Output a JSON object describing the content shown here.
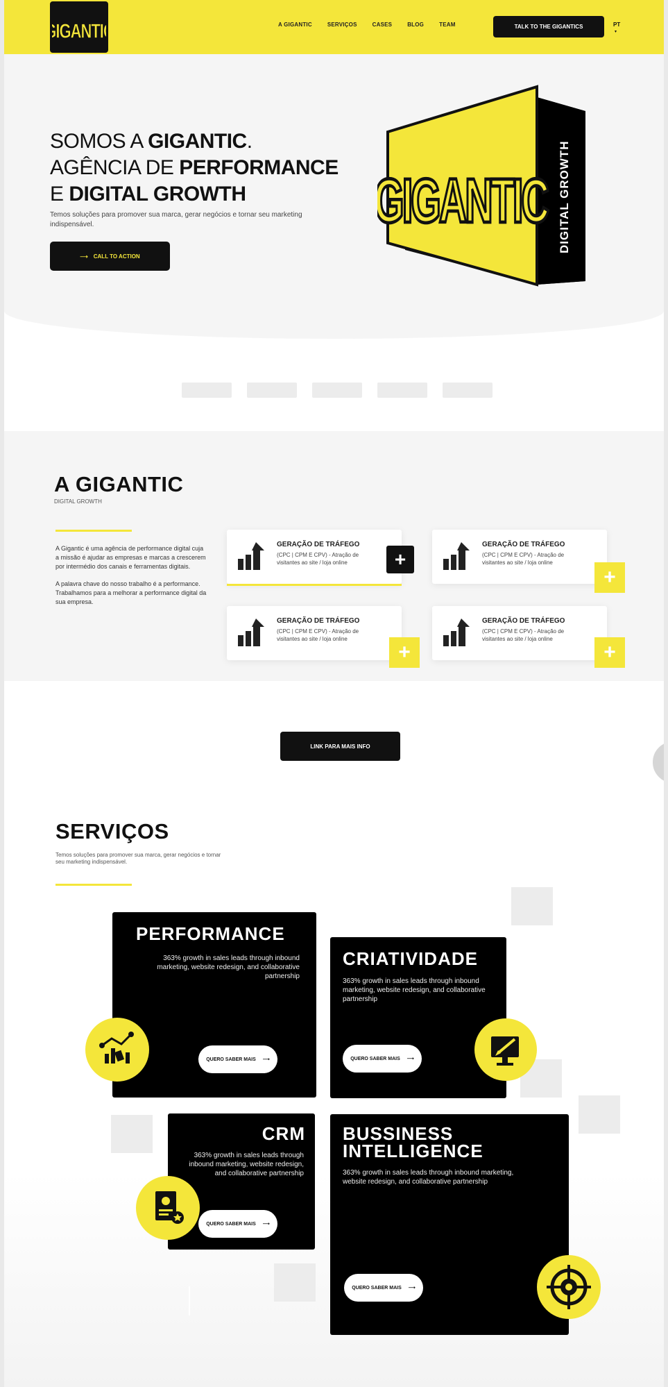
{
  "header": {
    "logo_text": "GIGANTIC",
    "nav": [
      "A GIGANTIC",
      "SERVIÇOS",
      "CASES",
      "BLOG",
      "TEAM"
    ],
    "cta_label": "TALK TO THE GIGANTICS",
    "lang": "PT",
    "lang_caret": "▾"
  },
  "hero": {
    "title_1a": "SOMOS A ",
    "title_1b": "GIGANTIC",
    "title_1c": ".",
    "title_2a": "AGÊNCIA DE ",
    "title_2b": "PERFORMANCE",
    "title_3a": "E ",
    "title_3b": "DIGITAL GROWTH",
    "subtitle": "Temos soluções para promover sua marca, gerar negócios e tornar seu marketing indispensável.",
    "cta_arrow": "⟶",
    "cta_label": "CALL TO ACTION",
    "art_word": "GIGANTIC",
    "art_side": "DIGITAL GROWTH"
  },
  "about": {
    "title": "A GIGANTIC",
    "subtitle": "DIGITAL GROWTH",
    "p1": "A Gigantic é uma agência de performance digital cuja a missão é ajudar as empresas e marcas a crescerem por intermédio dos canais e ferramentas digitais.",
    "p2": "A palavra chave do nosso trabalho é a performance.",
    "p3": "Trabalhamos para a melhorar a performance digital da sua empresa.",
    "cards": [
      {
        "title": "GERAÇÃO DE TRÁFEGO",
        "desc": "(CPC | CPM E CPV) - Atração de visitantes ao site / loja online"
      },
      {
        "title": "GERAÇÃO DE TRÁFEGO",
        "desc": "(CPC | CPM E CPV) - Atração de visitantes ao site / loja online"
      },
      {
        "title": "GERAÇÃO DE TRÁFEGO",
        "desc": "(CPC | CPM E CPV) - Atração de visitantes ao site / loja online"
      },
      {
        "title": "GERAÇÃO DE TRÁFEGO",
        "desc": "(CPC | CPM E CPV) - Atração de visitantes ao site / loja online"
      }
    ],
    "plus": "+",
    "more_label": "LINK PARA MAIS INFO"
  },
  "services": {
    "title": "SERVIÇOS",
    "subtitle": "Temos soluções para promover sua marca, gerar negócios e tornar seu marketing indispensável.",
    "button_label": "QUERO SABER MAIS",
    "button_arrow": "⟶",
    "items": [
      {
        "title": "PERFORMANCE",
        "desc": "363% growth in sales leads through inbound marketing, website redesign, and collaborative partnership"
      },
      {
        "title": "CRIATIVIDADE",
        "desc": "363% growth in sales leads through inbound marketing, website redesign, and collaborative partnership"
      },
      {
        "title": "CRM",
        "desc": "363% growth in sales leads through inbound marketing, website redesign, and collaborative partnership"
      },
      {
        "title": "BUSSINESS INTELLIGENCE",
        "desc": "363% growth in sales leads through inbound marketing, website redesign, and collaborative partnership"
      }
    ]
  },
  "colors": {
    "accent": "#f4e63a",
    "dark": "#111111",
    "background": "#f5f5f5"
  },
  "icons": [
    "logo",
    "arrow-right-icon",
    "bar-chart-icon",
    "plus-icon",
    "analytics-icon",
    "design-icon",
    "crm-icon",
    "bi-icon"
  ]
}
